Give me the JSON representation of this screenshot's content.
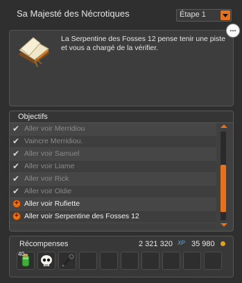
{
  "header": {
    "quest_title": "Sa Majesté des Nécrotiques",
    "step_selected": "Étape 1"
  },
  "description": {
    "text": "La Serpentine des Fosses 12 pense tenir une piste et vous a chargé de la vérifier.",
    "more_button": "..."
  },
  "objectives": {
    "title": "Objectifs",
    "items": [
      {
        "label": "Aller voir Merridiou",
        "state": "done"
      },
      {
        "label": "Vaincre Merridiou.",
        "state": "done"
      },
      {
        "label": "Aller voir Samuel",
        "state": "done"
      },
      {
        "label": "Aller voir Liame",
        "state": "done"
      },
      {
        "label": "Aller voir Rick",
        "state": "done"
      },
      {
        "label": "Aller voir Oldie",
        "state": "done"
      },
      {
        "label": "Aller voir Rufiette",
        "state": "active"
      },
      {
        "label": "Aller voir Serpentine des Fosses 12",
        "state": "active"
      }
    ]
  },
  "rewards": {
    "title": "Récompenses",
    "xp": "2 321 320",
    "xp_unit": "XP",
    "kamas": "35 980",
    "items": [
      {
        "icon": "green-potion-icon",
        "count": "40"
      },
      {
        "icon": "skull-icon",
        "count": ""
      },
      {
        "icon": "dark-wand-icon",
        "count": ""
      }
    ],
    "empty_slots": 7
  },
  "colors": {
    "accent": "#e8711c",
    "xp": "#6ab0e8"
  }
}
